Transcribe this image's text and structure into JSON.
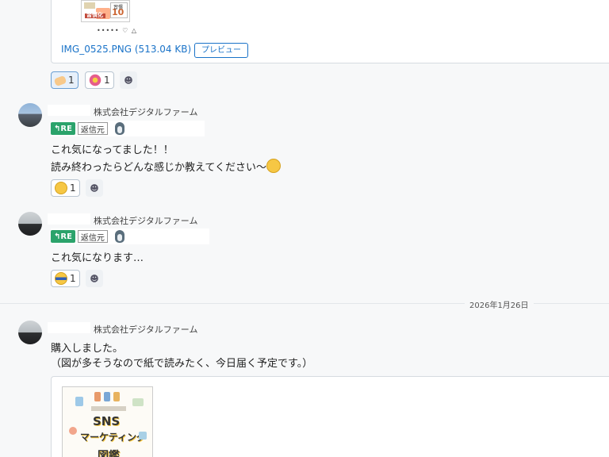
{
  "colors": {
    "link": "#1a73c8",
    "re_badge": "#2ba36b",
    "background": "#f7f8f9"
  },
  "attachment_top": {
    "thumbnail_text": [
      "習慣化",
      "10",
      "習慣"
    ],
    "thumbnail_footer": "•••••   ♡ △",
    "file_name": "IMG_0525.PNG (513.04 KB)",
    "preview_label": "プレビュー"
  },
  "reactions_1": [
    {
      "icon": "clap-hands-icon",
      "count": "1"
    },
    {
      "icon": "flower-icon",
      "count": "1"
    }
  ],
  "messages": [
    {
      "company": "株式会社デジタルファーム",
      "re_label": "RE",
      "re_source": "返信元",
      "lines": [
        "これ気になってました！！",
        "読み終わったらどんな感じか教えてください〜"
      ],
      "inline_emoji": "grin-face-icon",
      "reaction": {
        "icon": "grin-face-icon",
        "count": "1"
      }
    },
    {
      "company": "株式会社デジタルファーム",
      "re_label": "RE",
      "re_source": "返信元",
      "lines": [
        "これ気になります…"
      ],
      "reaction": {
        "icon": "cool-face-icon",
        "count": "1"
      }
    }
  ],
  "date_divider": "2026年1月26日",
  "message_3": {
    "company": "株式会社デジタルファーム",
    "lines": [
      "購入しました。",
      "（図が多そうなので紙で読みたく、今日届く予定です。）"
    ],
    "thumbnail_text": [
      "SNS",
      "マーケティング",
      "図鑑"
    ]
  }
}
